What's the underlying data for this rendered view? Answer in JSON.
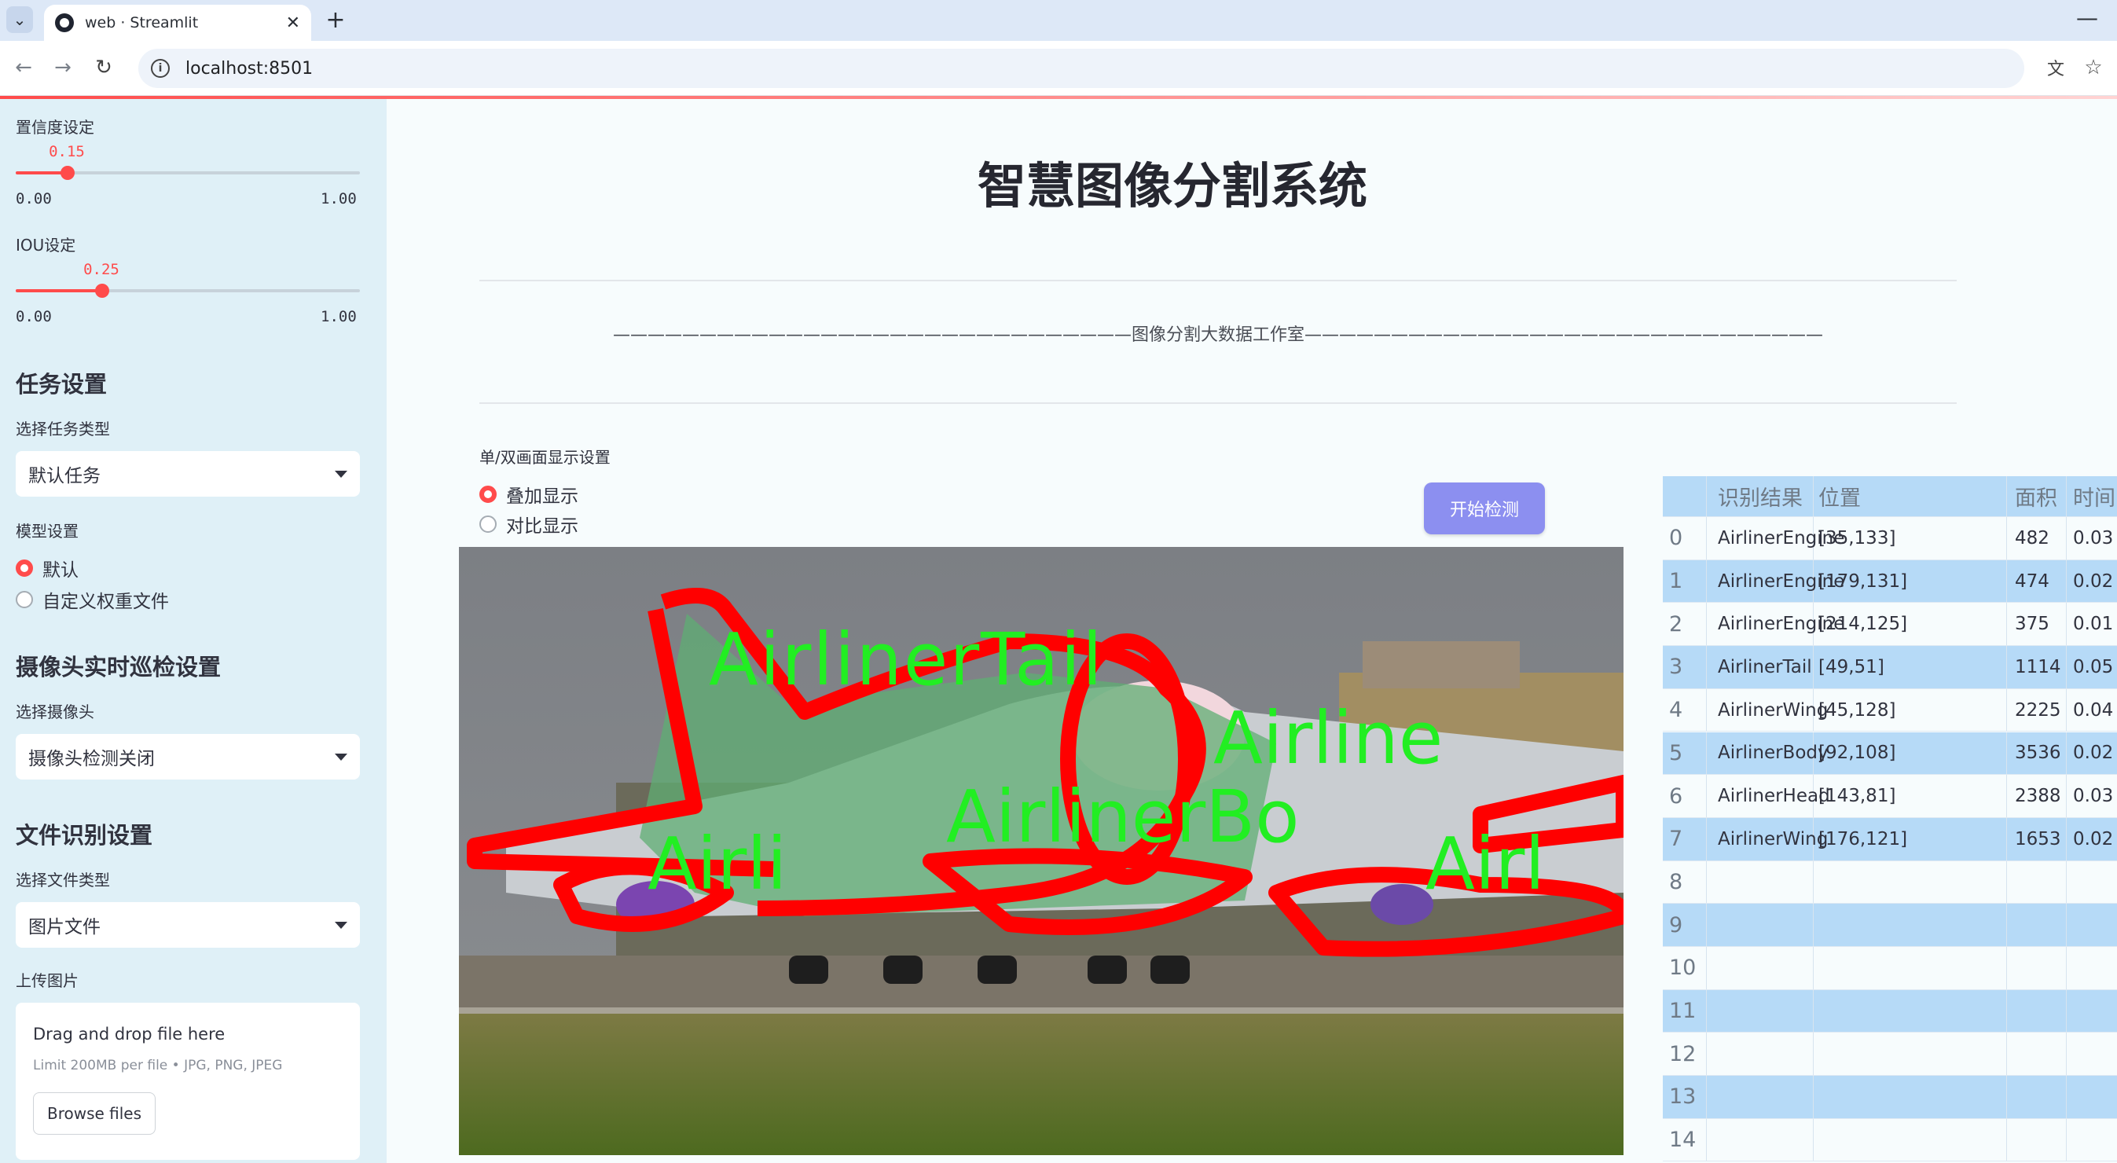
{
  "browser": {
    "tab_title": "web · Streamlit",
    "url": "localhost:8501"
  },
  "sidebar": {
    "confidence": {
      "label": "置信度设定",
      "value": "0.15",
      "value_num": 0.15,
      "min": "0.00",
      "max": "1.00"
    },
    "iou": {
      "label": "IOU设定",
      "value": "0.25",
      "value_num": 0.25,
      "min": "0.00",
      "max": "1.00"
    },
    "task_heading": "任务设置",
    "task_type_label": "选择任务类型",
    "task_type_value": "默认任务",
    "model_label": "模型设置",
    "model_options": [
      "默认",
      "自定义权重文件"
    ],
    "model_selected": 0,
    "camera_heading": "摄像头实时巡检设置",
    "camera_label": "选择摄像头",
    "camera_value": "摄像头检测关闭",
    "file_heading": "文件识别设置",
    "file_type_label": "选择文件类型",
    "file_type_value": "图片文件",
    "upload_label": "上传图片",
    "upload_title": "Drag and drop file here",
    "upload_hint": "Limit 200MB per file • JPG, PNG, JPEG",
    "browse_label": "Browse files"
  },
  "main": {
    "title": "智慧图像分割系统",
    "studio_text": "——————————————————————————————图像分割大数据工作室——————————————————————————————",
    "display_label": "单/双画面显示设置",
    "display_options": [
      "叠加显示",
      "对比显示"
    ],
    "display_selected": 0,
    "start_button": "开始检测",
    "image_labels": [
      "AirlinerTail",
      "Airline",
      "AirlinerBo",
      "Airli",
      "Airl"
    ]
  },
  "table": {
    "columns": [
      "",
      "识别结果",
      "位置",
      "面积",
      "时间"
    ],
    "rows": [
      [
        "0",
        "AirlinerEngine",
        "[35,133]",
        "482",
        "0.03"
      ],
      [
        "1",
        "AirlinerEngine",
        "[179,131]",
        "474",
        "0.02"
      ],
      [
        "2",
        "AirlinerEngine",
        "[214,125]",
        "375",
        "0.01"
      ],
      [
        "3",
        "AirlinerTail",
        "[49,51]",
        "1114",
        "0.05"
      ],
      [
        "4",
        "AirlinerWing",
        "[45,128]",
        "2225",
        "0.04"
      ],
      [
        "5",
        "AirlinerBody",
        "[92,108]",
        "3536",
        "0.02"
      ],
      [
        "6",
        "AirlinerHead",
        "[143,81]",
        "2388",
        "0.03"
      ],
      [
        "7",
        "AirlinerWing",
        "[176,121]",
        "1653",
        "0.02"
      ],
      [
        "8",
        "",
        "",
        "",
        ""
      ],
      [
        "9",
        "",
        "",
        "",
        ""
      ],
      [
        "10",
        "",
        "",
        "",
        ""
      ],
      [
        "11",
        "",
        "",
        "",
        ""
      ],
      [
        "12",
        "",
        "",
        "",
        ""
      ],
      [
        "13",
        "",
        "",
        "",
        ""
      ],
      [
        "14",
        "",
        "",
        "",
        ""
      ]
    ]
  },
  "colors": {
    "accent": "#ff4b4b",
    "sidebar_bg": "#dff0f7",
    "table_stripe": "#b6daf7",
    "button": "#8c8ff0",
    "mask_outline": "#ff0000",
    "mask_label": "#22ee22"
  }
}
